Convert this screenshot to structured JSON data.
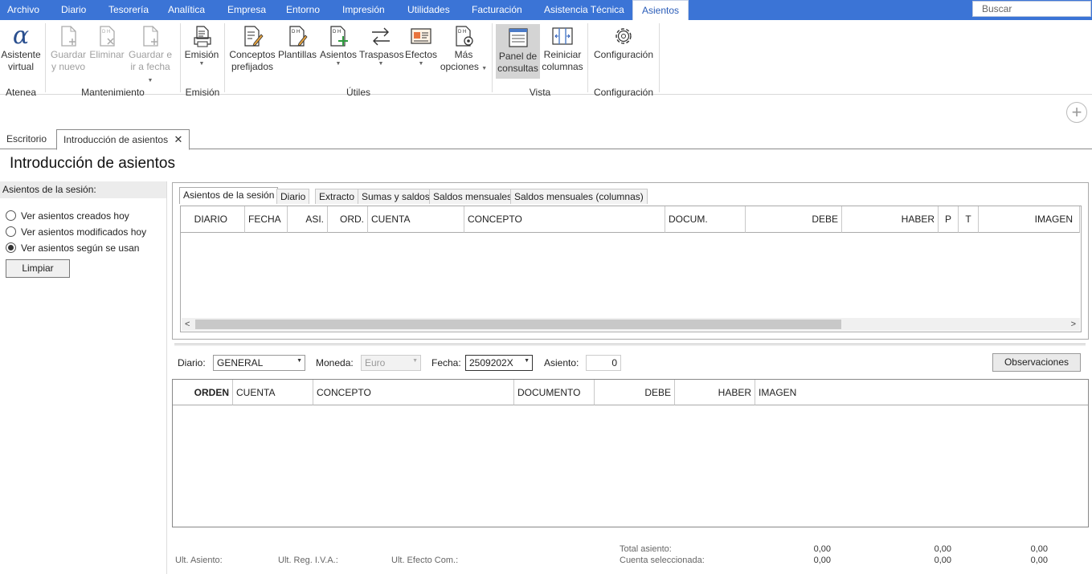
{
  "menubar": {
    "items": [
      "Archivo",
      "Diario",
      "Tesorería",
      "Analítica",
      "Empresa",
      "Entorno",
      "Impresión",
      "Utilidades",
      "Facturación",
      "Asistencia Técnica",
      "Asientos"
    ],
    "search_placeholder": "Buscar"
  },
  "ribbon": {
    "buttons": {
      "asistente": [
        "Asistente",
        "virtual"
      ],
      "guardar_nuevo": [
        "Guardar",
        "y nuevo"
      ],
      "eliminar": [
        "Eliminar"
      ],
      "guardar_fecha": [
        "Guardar e",
        "ir a fecha"
      ],
      "emision": [
        "Emisión"
      ],
      "conceptos": [
        "Conceptos",
        "prefijados"
      ],
      "plantillas": [
        "Plantillas"
      ],
      "asientos": [
        "Asientos"
      ],
      "traspasos": [
        "Traspasos"
      ],
      "efectos": [
        "Efectos"
      ],
      "mas_opciones": [
        "Más",
        "opciones"
      ],
      "panel": [
        "Panel de",
        "consultas"
      ],
      "reiniciar": [
        "Reiniciar",
        "columnas"
      ],
      "configuracion": [
        "Configuración"
      ]
    },
    "groups": [
      "Atenea",
      "Mantenimiento",
      "Emisión",
      "Útiles",
      "Vista",
      "Configuración"
    ]
  },
  "doc_tabs": [
    "Escritorio",
    "Introducción de asientos"
  ],
  "page_title": "Introducción de asientos",
  "left_panel": {
    "heading": "Asientos de la sesión:",
    "options": [
      "Ver asientos creados hoy",
      "Ver asientos modificados hoy",
      "Ver asientos según se usan"
    ],
    "selected_index": 2,
    "clear_label": "Limpiar"
  },
  "session_tabs": [
    "Asientos de la sesión",
    "Diario",
    "Extracto",
    "Sumas y saldos",
    "Saldos mensuales",
    "Saldos mensuales (columnas)"
  ],
  "session_grid_columns": [
    "DIARIO",
    "FECHA",
    "ASI.",
    "ORD.",
    "CUENTA",
    "CONCEPTO",
    "DOCUM.",
    "DEBE",
    "HABER",
    "P",
    "T",
    "IMAGEN"
  ],
  "form": {
    "diario_label": "Diario:",
    "diario_value": "GENERAL",
    "moneda_label": "Moneda:",
    "moneda_value": "Euro",
    "fecha_label": "Fecha:",
    "fecha_value": "2509202X",
    "asiento_label": "Asiento:",
    "asiento_value": "0",
    "observaciones_label": "Observaciones"
  },
  "entry_grid_columns": [
    "ORDEN",
    "CUENTA",
    "CONCEPTO",
    "DOCUMENTO",
    "DEBE",
    "HABER",
    "IMAGEN"
  ],
  "footer": {
    "ult_asiento": "Ult. Asiento:",
    "ult_reg_iva": "Ult. Reg. I.V.A.:",
    "ult_efecto": "Ult. Efecto Com.:",
    "total_asiento": "Total asiento:",
    "cuenta_sel": "Cuenta seleccionada:",
    "total_vals": [
      "0,00",
      "0,00",
      "0,00"
    ],
    "cuenta_vals": [
      "0,00",
      "0,00",
      "0,00"
    ]
  },
  "colors": {
    "menubar": "#3b74d6",
    "accent": "#2a5cb8"
  }
}
